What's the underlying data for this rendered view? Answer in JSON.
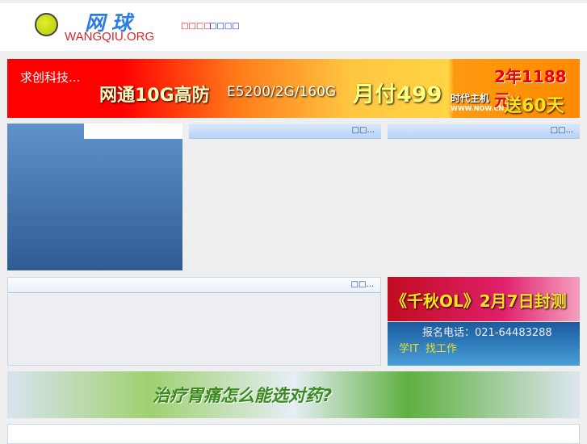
{
  "header": {
    "logo_cn": "网球",
    "logo_en": "WANGQIU.ORG",
    "nav": [
      "□□□□",
      "□□□□"
    ]
  },
  "banner_top": {
    "company": "求创科技...",
    "headline": "网通10G高防",
    "spec": "E5200/2G/160G",
    "price": "月付499",
    "brand": "时代主机",
    "url": "WWW.NOW.CN",
    "promo1": "2年1188元",
    "promo2": "送60天"
  },
  "boxes": {
    "more": "□□..."
  },
  "ad_side": {
    "title": "《千秋OL》2月7日封测",
    "phone": "报名电话：021-64483288",
    "slogan": "学IT  找工作"
  },
  "banner_bottom": {
    "text": "治疗胃痛怎么能选对药?"
  }
}
